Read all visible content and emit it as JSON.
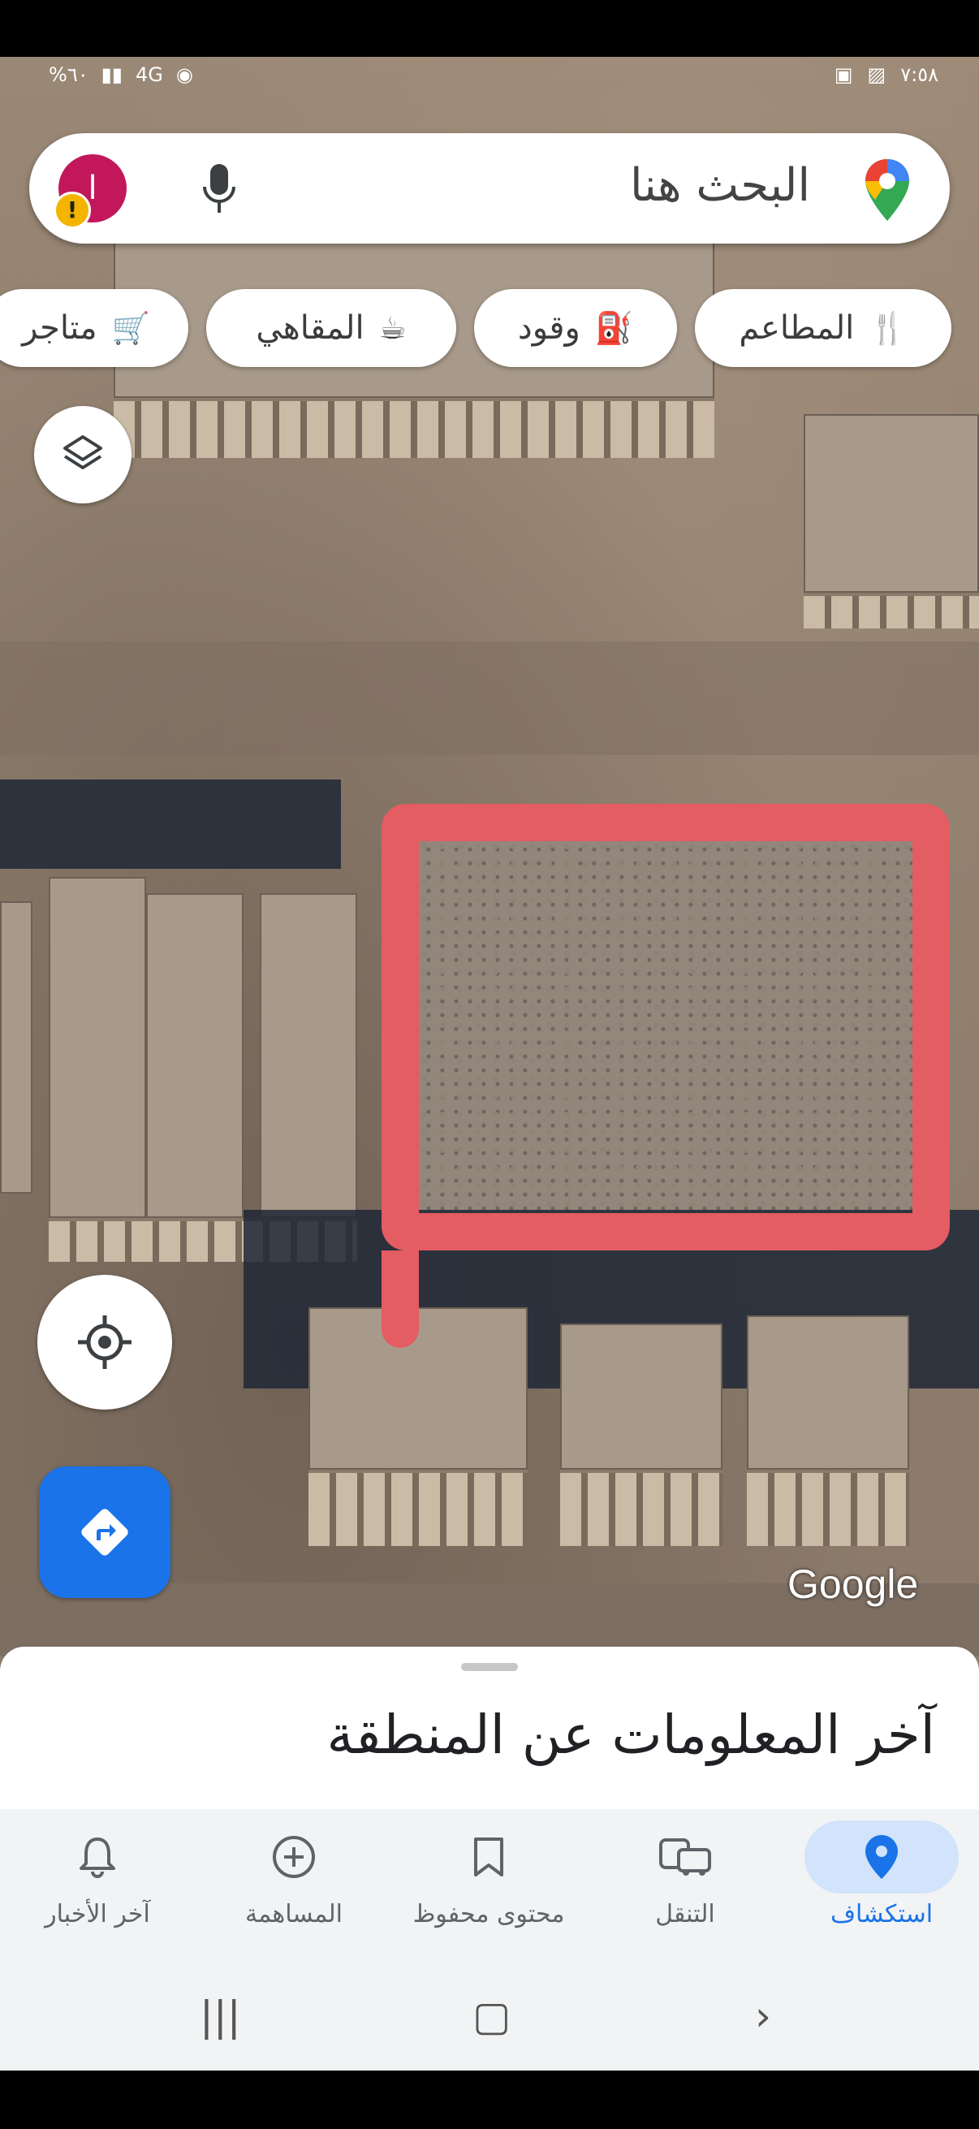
{
  "status_bar": {
    "battery": "%٦٠",
    "network": "4G",
    "time": "٧:٥٨"
  },
  "search": {
    "placeholder": "البحث هنا",
    "avatar_letter": "ا",
    "alert_mark": "!"
  },
  "chips": [
    {
      "label": "المطاعم",
      "icon": "restaurant-icon"
    },
    {
      "label": "وقود",
      "icon": "fuel-icon"
    },
    {
      "label": "المقاهي",
      "icon": "coffee-icon"
    },
    {
      "label": "متاجر",
      "icon": "cart-icon"
    }
  ],
  "map": {
    "attribution": "Google",
    "annotation_color": "#e35d63",
    "layers_icon": "layers-icon",
    "locate_icon": "my-location-icon",
    "directions_icon": "directions-icon"
  },
  "sheet": {
    "title": "آخر المعلومات عن المنطقة"
  },
  "bottom_nav": [
    {
      "label": "استكشاف",
      "icon": "explore-pin-icon",
      "active": true
    },
    {
      "label": "التنقل",
      "icon": "commute-icon",
      "active": false
    },
    {
      "label": "محتوى محفوظ",
      "icon": "bookmark-icon",
      "active": false
    },
    {
      "label": "المساهمة",
      "icon": "add-circle-icon",
      "active": false
    },
    {
      "label": "آخر الأخبار",
      "icon": "bell-icon",
      "active": false
    }
  ],
  "colors": {
    "accent": "#1a73e8",
    "active_pill": "#d2e3fc"
  }
}
